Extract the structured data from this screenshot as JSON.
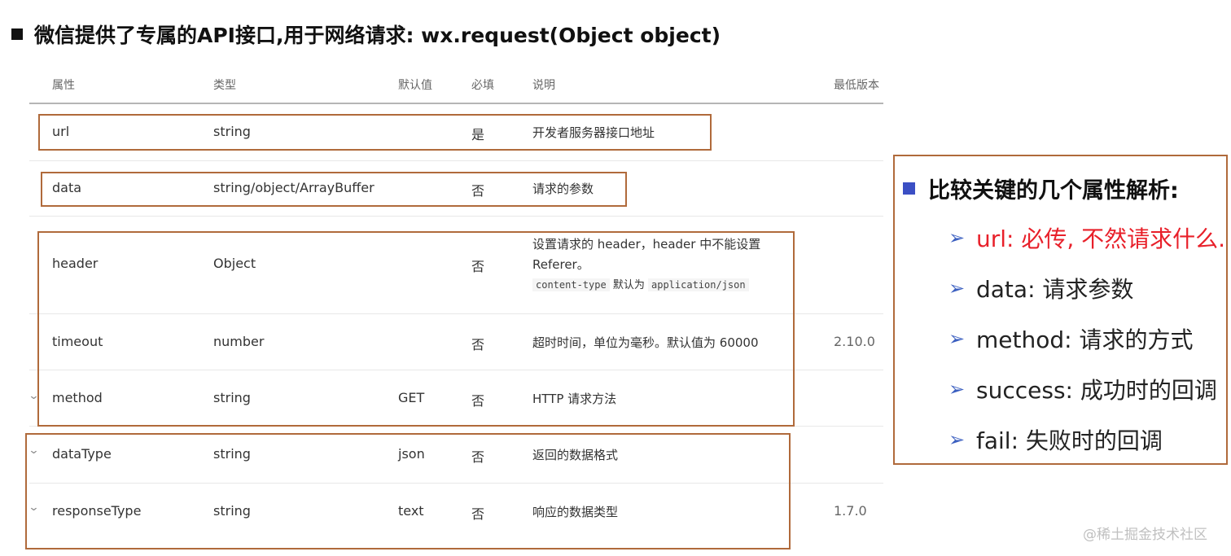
{
  "title": "微信提供了专属的API接口,用于网络请求: wx.request(Object object)",
  "table": {
    "headers": {
      "name": "属性",
      "type": "类型",
      "default": "默认值",
      "required": "必填",
      "desc": "说明",
      "version": "最低版本"
    },
    "rows": [
      {
        "name": "url",
        "type": "string",
        "default": "",
        "required": "是",
        "desc": "开发者服务器接口地址",
        "version": ""
      },
      {
        "name": "data",
        "type": "string/object/ArrayBuffer",
        "default": "",
        "required": "否",
        "desc": "请求的参数",
        "version": ""
      },
      {
        "name": "header",
        "type": "Object",
        "default": "",
        "required": "否",
        "desc_line1": "设置请求的 header，header 中不能设置",
        "desc_line2": "Referer。",
        "desc_code1": "content-type",
        "desc_mid": "默认为",
        "desc_code2": "application/json",
        "version": ""
      },
      {
        "name": "timeout",
        "type": "number",
        "default": "",
        "required": "否",
        "desc": "超时时间，单位为毫秒。默认值为 60000",
        "version": "2.10.0"
      },
      {
        "name": "method",
        "type": "string",
        "default": "GET",
        "required": "否",
        "desc": "HTTP 请求方法",
        "version": ""
      },
      {
        "name": "dataType",
        "type": "string",
        "default": "json",
        "required": "否",
        "desc": "返回的数据格式",
        "version": ""
      },
      {
        "name": "responseType",
        "type": "string",
        "default": "text",
        "required": "否",
        "desc": "响应的数据类型",
        "version": "1.7.0"
      }
    ]
  },
  "panel": {
    "title": "比较关键的几个属性解析:",
    "items": [
      "url: 必传, 不然请求什么.",
      "data: 请求参数",
      "method: 请求的方式",
      "success: 成功时的回调",
      "fail: 失败时的回调"
    ]
  },
  "watermark": "@稀土掘金技术社区",
  "colors": {
    "box_border": "#b06a3b",
    "highlight_red": "#e8202a",
    "bullet_blue": "#3b4fc4"
  }
}
